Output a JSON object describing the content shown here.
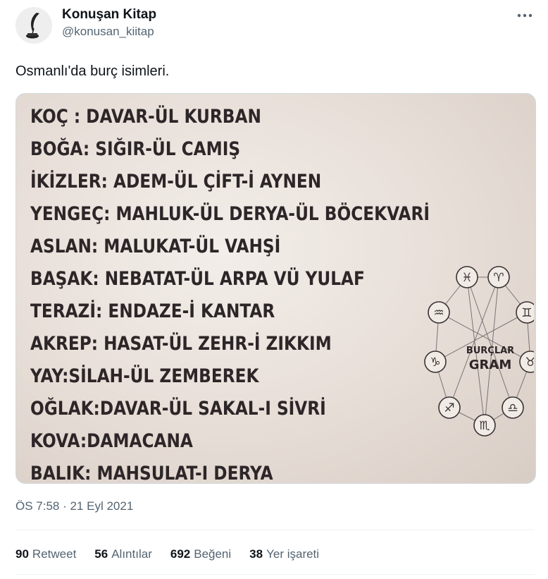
{
  "author": {
    "display_name": "Konuşan Kitap",
    "handle": "@konusan_kiitap"
  },
  "tweet": {
    "text": "Osmanlı'da burç isimleri."
  },
  "image": {
    "lines": [
      "KOÇ : DAVAR-ÜL KURBAN",
      "BOĞA: SIĞIR-ÜL CAMIŞ",
      "İKİZLER: ADEM-ÜL ÇİFT-İ AYNEN",
      "YENGEÇ: MAHLUK-ÜL DERYA-ÜL BÖCEKVARİ",
      "ASLAN: MALUKAT-ÜL VAHŞİ",
      "BAŞAK: NEBATAT-ÜL ARPA VÜ YULAF",
      "TERAZİ: ENDAZE-İ KANTAR",
      "AKREP: HASAT-ÜL ZEHR-İ ZIKKIM",
      "YAY:SİLAH-ÜL ZEMBEREK",
      "OĞLAK:DAVAR-ÜL SAKAL-I SİVRİ",
      "KOVA:DAMACANA",
      "BALIK: MAHSULAT-I DERYA"
    ],
    "logo_text": [
      "BURÇLAR",
      "GRAM"
    ]
  },
  "meta": {
    "timestamp": "ÖS 7:58 · 21 Eyl 2021"
  },
  "stats": [
    {
      "count": "90",
      "label": "Retweet"
    },
    {
      "count": "56",
      "label": "Alıntılar"
    },
    {
      "count": "692",
      "label": "Beğeni"
    },
    {
      "count": "38",
      "label": "Yer işareti"
    }
  ],
  "colors": {
    "text": "#0f1419",
    "secondary": "#536471",
    "border": "#eff3f4"
  }
}
